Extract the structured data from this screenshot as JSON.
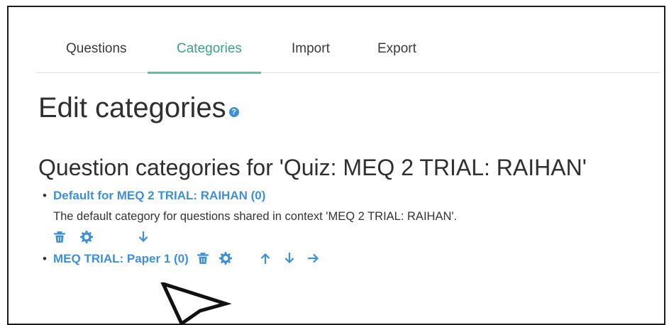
{
  "tabs": [
    {
      "label": "Questions",
      "active": false
    },
    {
      "label": "Categories",
      "active": true
    },
    {
      "label": "Import",
      "active": false
    },
    {
      "label": "Export",
      "active": false
    }
  ],
  "page_title": "Edit categories",
  "section_title": "Question categories for 'Quiz: MEQ 2 TRIAL: RAIHAN'",
  "categories": [
    {
      "name": "Default for MEQ 2 TRIAL: RAIHAN (0)",
      "description": "The default category for questions shared in context 'MEQ 2 TRIAL: RAIHAN'.",
      "actions": [
        "trash-icon",
        "gear-icon",
        "arrow-down-icon"
      ]
    },
    {
      "name": "MEQ TRIAL: Paper 1 (0)",
      "description": "",
      "actions": [
        "trash-icon",
        "gear-icon",
        "arrow-up-icon",
        "arrow-down-icon",
        "arrow-right-icon"
      ]
    }
  ],
  "colors": {
    "accent_tab": "#3f9d88",
    "link": "#3e8fd6",
    "text": "#333333"
  }
}
